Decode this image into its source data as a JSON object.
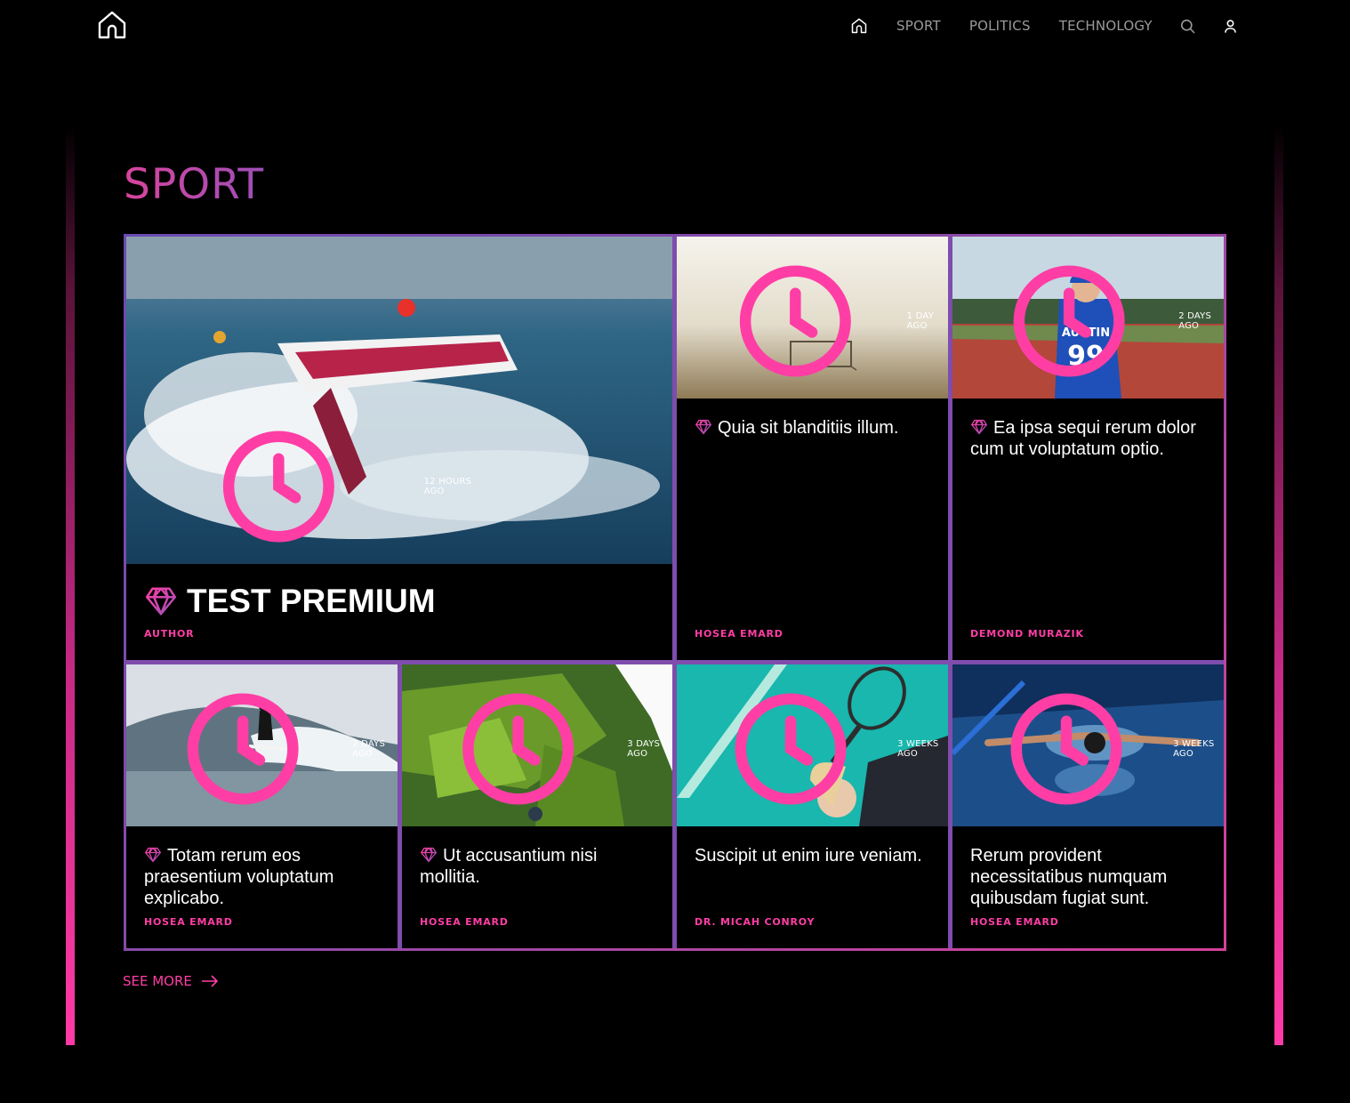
{
  "header": {
    "nav": [
      {
        "label": "SPORT"
      },
      {
        "label": "POLITICS"
      },
      {
        "label": "TECHNOLOGY"
      }
    ],
    "icons": [
      "home-icon",
      "search-icon",
      "user-icon"
    ]
  },
  "section": {
    "title": "SPORT",
    "see_more": "SEE MORE"
  },
  "colors": {
    "accent_pink": "#ff3ea5",
    "accent_purple": "#9c4fb8",
    "background": "#000000"
  },
  "articles": [
    {
      "premium": true,
      "time": "12 HOURS AGO",
      "title": "TEST PREMIUM",
      "author": "AUTHOR",
      "image": "jet-ski-photo"
    },
    {
      "premium": true,
      "time": "1 DAY AGO",
      "title": "Quia sit blanditiis illum.",
      "author": "HOSEA EMARD",
      "image": "foggy-soccer-goal-photo"
    },
    {
      "premium": true,
      "time": "2 DAYS AGO",
      "title": "Ea ipsa sequi rerum dolor cum ut voluptatum optio.",
      "author": "DEMOND MURAZIK",
      "image": "baseball-kid-photo"
    },
    {
      "premium": true,
      "time": "2 DAYS AGO",
      "title": "Totam rerum eos praesentium voluptatum explicabo.",
      "author": "HOSEA EMARD",
      "image": "surfer-photo"
    },
    {
      "premium": true,
      "time": "3 DAYS AGO",
      "title": "Ut accusantium nisi mollitia.",
      "author": "HOSEA EMARD",
      "image": "mossy-cliff-photo"
    },
    {
      "premium": false,
      "time": "3 WEEKS AGO",
      "title": "Suscipit ut enim iure veniam.",
      "author": "DR. MICAH CONROY",
      "image": "tennis-player-photo"
    },
    {
      "premium": false,
      "time": "3 WEEKS AGO",
      "title": "Rerum provident necessitatibus numquam quibusdam fugiat sunt.",
      "author": "HOSEA EMARD",
      "image": "swimmer-photo"
    }
  ],
  "sample_image_text": {
    "jersey_name": "AUSTIN",
    "jersey_number": "99"
  }
}
